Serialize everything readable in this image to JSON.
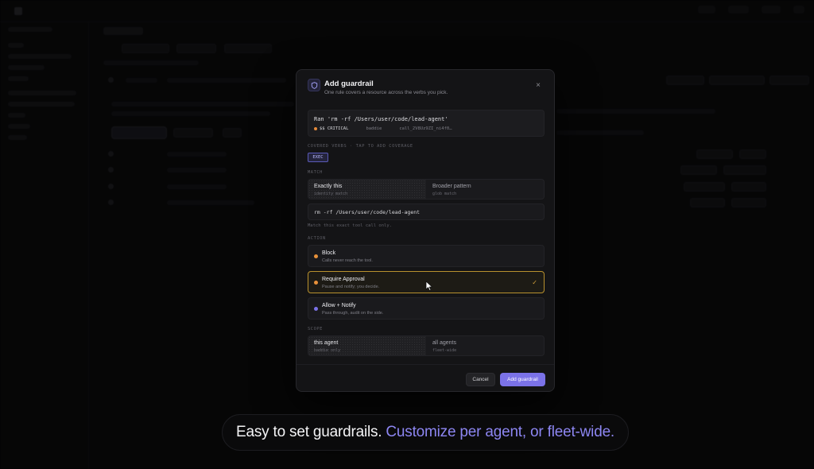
{
  "colors": {
    "accent": "#7b72e8",
    "critical": "#e58a3a",
    "selected_border": "#b8912e",
    "block_dot": "#e8913a",
    "approval_dot": "#e8913a",
    "allow_dot": "#7b72e8"
  },
  "modal": {
    "icon": "shield-icon",
    "title": "Add guardrail",
    "subtitle": "One rule covers a resource across the verbs you pick.",
    "close": "×",
    "command": {
      "text": "Ran 'rm -rf /Users/user/code/lead-agent'",
      "severity": "$$ CRITICAL",
      "agent": "baddie",
      "call_id": "call_2V8Uz9ZI_ni4f0…"
    },
    "verbs": {
      "label": "COVERED VERBS · TAP TO ADD COVERAGE",
      "items": [
        "EXEC"
      ]
    },
    "match": {
      "label": "MATCH",
      "options": [
        {
          "title": "Exactly this",
          "sub": "identity match"
        },
        {
          "title": "Broader pattern",
          "sub": "glob match"
        }
      ],
      "value": "rm -rf /Users/user/code/lead-agent",
      "help": "Match this exact tool call only."
    },
    "action": {
      "label": "ACTION",
      "options": [
        {
          "title": "Block",
          "desc": "Calls never reach the tool."
        },
        {
          "title": "Require Approval",
          "desc": "Pause and notify; you decide."
        },
        {
          "title": "Allow + Notify",
          "desc": "Pass through, audit on the side."
        }
      ],
      "selected": "Require Approval",
      "check": "✓"
    },
    "scope": {
      "label": "SCOPE",
      "options": [
        {
          "title": "this agent",
          "sub": "baddie only"
        },
        {
          "title": "all agents",
          "sub": "fleet-wide"
        }
      ]
    },
    "footer": {
      "cancel": "Cancel",
      "submit": "Add guardrail"
    }
  },
  "caption": {
    "part1": "Easy to set guardrails.",
    "part2": "Customize per agent, or fleet-wide."
  }
}
